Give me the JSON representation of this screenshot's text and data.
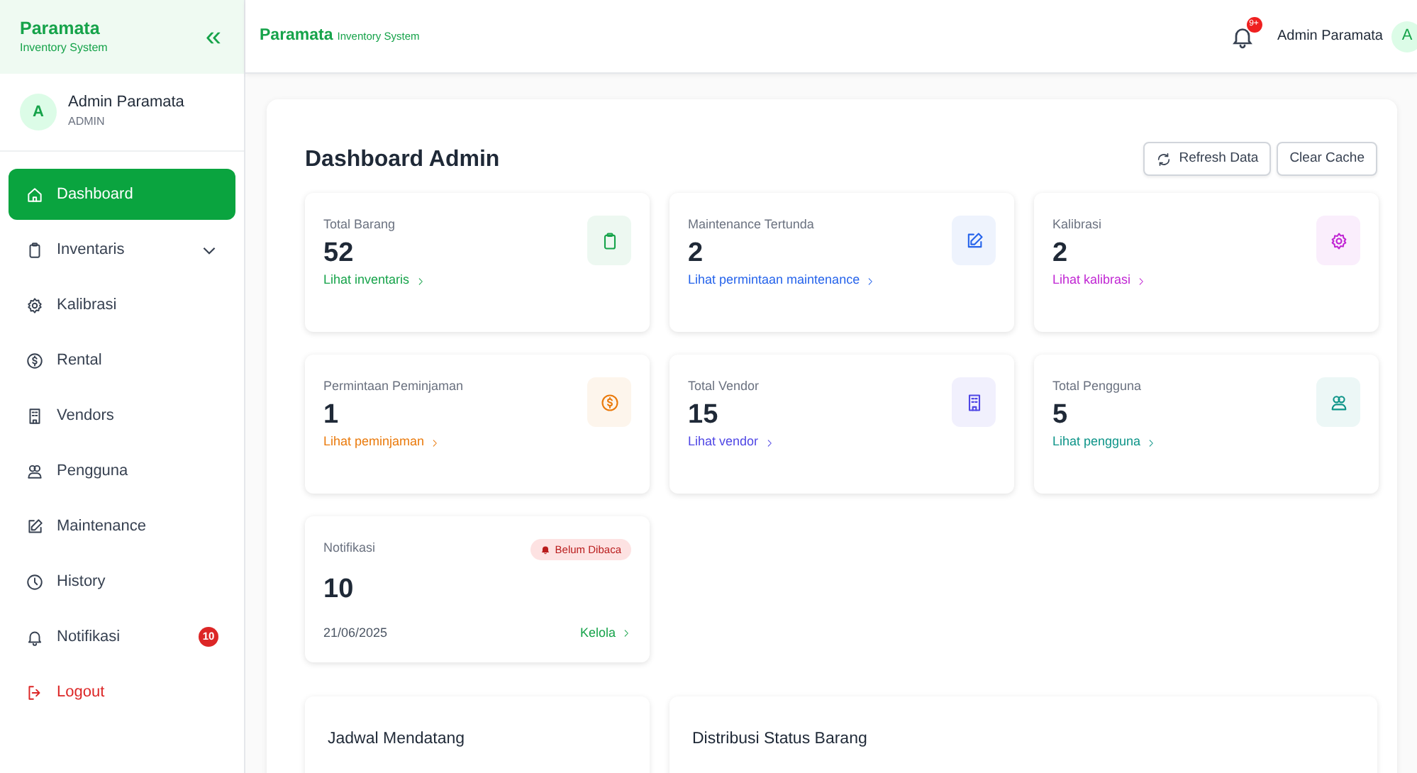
{
  "brand": {
    "name": "Paramata",
    "subtitle": "Inventory System",
    "collapse": "«"
  },
  "user": {
    "avatar": "A",
    "name": "Admin Paramata",
    "role": "ADMIN"
  },
  "sidebar": {
    "items": [
      {
        "label": "Dashboard",
        "kind": "link",
        "selected": true
      },
      {
        "label": "Inventaris",
        "kind": "dropdown",
        "selected": false
      },
      {
        "label": "Kalibrasi",
        "kind": "link",
        "selected": false
      },
      {
        "label": "Rental",
        "kind": "link",
        "selected": false
      },
      {
        "label": "Vendors",
        "kind": "link",
        "selected": false
      },
      {
        "label": "Pengguna",
        "kind": "link",
        "selected": false
      },
      {
        "label": "Maintenance",
        "kind": "link",
        "selected": false
      },
      {
        "label": "History",
        "kind": "link",
        "selected": false
      },
      {
        "label": "Notifikasi",
        "kind": "link",
        "selected": false,
        "badge": "10"
      },
      {
        "label": "Logout",
        "kind": "logout",
        "selected": false
      }
    ]
  },
  "topbar": {
    "brand": "Paramata",
    "subtitle": "Inventory System",
    "notification_badge": "9+",
    "user_name": "Admin Paramata",
    "avatar": "A"
  },
  "dashboard": {
    "title": "Dashboard Admin",
    "buttons": [
      {
        "label": "Refresh Data",
        "kind": "refresh"
      },
      {
        "label": "Clear Cache",
        "kind": "plain"
      }
    ],
    "cards": [
      {
        "kind": "stat",
        "label": "Total Barang",
        "value": "52",
        "link": "Lihat inventaris",
        "color": "#16a34a"
      },
      {
        "kind": "stat",
        "label": "Maintenance Tertunda",
        "value": "2",
        "link": "Lihat permintaan maintenance",
        "color": "#2563eb"
      },
      {
        "kind": "stat",
        "label": "Kalibrasi",
        "value": "2",
        "link": "Lihat kalibrasi",
        "color": "#c026d3"
      },
      {
        "kind": "stat",
        "label": "Permintaan Peminjaman",
        "value": "1",
        "link": "Lihat peminjaman",
        "color": "#ea7a0c"
      },
      {
        "kind": "stat",
        "label": "Total Vendor",
        "value": "15",
        "link": "Lihat vendor",
        "color": "#4f46e5"
      },
      {
        "kind": "stat",
        "label": "Total Pengguna",
        "value": "5",
        "link": "Lihat pengguna",
        "color": "#0d9488"
      },
      {
        "kind": "notification",
        "label": "Notifikasi",
        "value": "10",
        "badge": "Belum Dibaca",
        "date": "21/06/2025",
        "link": "Kelola",
        "color": "#16a34a"
      }
    ],
    "panels": [
      {
        "title": "Jadwal Mendatang"
      },
      {
        "title": "Distribusi Status Barang"
      }
    ]
  }
}
